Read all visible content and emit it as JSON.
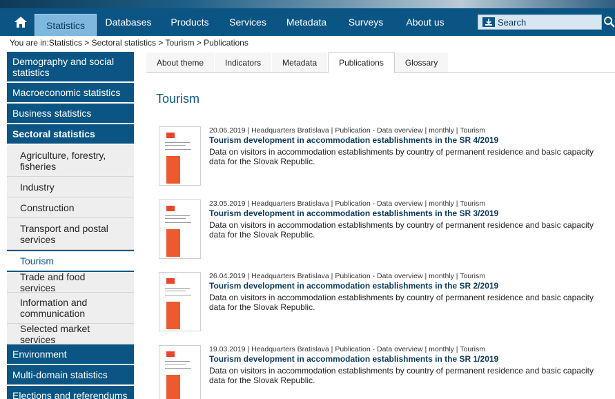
{
  "nav": {
    "items": [
      "Statistics",
      "Databases",
      "Products",
      "Services",
      "Metadata",
      "Surveys",
      "About us"
    ],
    "active_index": 0,
    "search_label": "Search"
  },
  "breadcrumb": "You are in:Statistics > Sectoral statistics > Tourism > Publications",
  "sidebar": {
    "items": [
      {
        "label": "Demography and social statistics",
        "type": "main"
      },
      {
        "label": "Macroeconomic statistics",
        "type": "main"
      },
      {
        "label": "Business statistics",
        "type": "main"
      },
      {
        "label": "Sectoral statistics",
        "type": "main-bold"
      },
      {
        "label": "Agriculture, forestry, fisheries",
        "type": "sub"
      },
      {
        "label": "Industry",
        "type": "sub"
      },
      {
        "label": "Construction",
        "type": "sub"
      },
      {
        "label": "Transport and postal services",
        "type": "sub"
      },
      {
        "label": "Tourism",
        "type": "sub-active"
      },
      {
        "label": "Trade and food services",
        "type": "sub"
      },
      {
        "label": "Information and communication",
        "type": "sub"
      },
      {
        "label": "Selected market services",
        "type": "sub"
      },
      {
        "label": "Environment",
        "type": "main"
      },
      {
        "label": "Multi-domain statistics",
        "type": "main"
      },
      {
        "label": "Elections and referendums",
        "type": "main"
      }
    ]
  },
  "tabs": [
    "About theme",
    "Indicators",
    "Metadata",
    "Publications",
    "Glossary"
  ],
  "active_tab": 3,
  "page_title": "Tourism",
  "publications": [
    {
      "meta": "20.06.2019 | Headquarters Bratislava | Publication - Data overview | monthly | Tourism",
      "title": "Tourism development in accommodation establishments in the SR 4/2019",
      "desc": "Data on visitors in accommodation establishments by country of permanent residence and basic capacity data for the Slovak Republic."
    },
    {
      "meta": "23.05.2019 | Headquarters Bratislava | Publication - Data overview | monthly | Tourism",
      "title": "Tourism development in accommodation establishments in the SR 3/2019",
      "desc": "Data on visitors in accommodation establishments by country of permanent residence and basic capacity data for the Slovak Republic."
    },
    {
      "meta": "26.04.2019 | Headquarters Bratislava | Publication - Data overview | monthly | Tourism",
      "title": "Tourism development in accommodation establishments in the SR 2/2019",
      "desc": "Data on visitors in accommodation establishments by country of permanent residence and basic capacity data for the Slovak Republic."
    },
    {
      "meta": "19.03.2019 | Headquarters Bratislava | Publication - Data overview | monthly | Tourism",
      "title": "Tourism development in accommodation establishments in the SR 1/2019",
      "desc": "Data on visitors in accommodation establishments by country of permanent residence and basic capacity data for the Slovak Republic."
    }
  ],
  "colors": {
    "nav": "#0b5585",
    "accent": "#0b5585",
    "cover": "#ee5a30"
  }
}
